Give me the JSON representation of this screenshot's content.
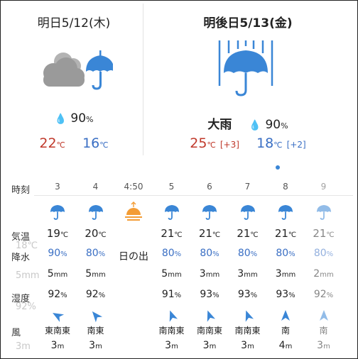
{
  "days": [
    {
      "date": "明日5/12(木)",
      "icon": "cloud-umbrella-icon",
      "prob": "90",
      "prob_unit": "%",
      "hi": "22",
      "lo": "16",
      "unit": "℃"
    },
    {
      "date": "明後日5/13(金)",
      "icon": "heavy-rain-umbrella-icon",
      "weather": "大雨",
      "prob": "90",
      "prob_unit": "%",
      "hi": "25",
      "lo": "18",
      "hi_diff": "[+3]",
      "lo_diff": "[+2]",
      "unit": "℃"
    }
  ],
  "labels": {
    "time": "時刻",
    "temp": "気温",
    "precip": "降水",
    "humidity": "湿度",
    "wind": "風",
    "sunrise": "日の出"
  },
  "ghost": {
    "temp": "18℃",
    "prob": "90%",
    "mm": "5mm",
    "hum": "92%",
    "wind": "3m"
  },
  "hours": [
    {
      "hour": "3",
      "temp": "19",
      "prob": "90",
      "mm": "5",
      "hum": "92",
      "dir": "東南東",
      "wind": "3",
      "arrow_deg": 300
    },
    {
      "hour": "4",
      "temp": "20",
      "prob": "80",
      "mm": "5",
      "hum": "92",
      "dir": "南東",
      "wind": "3",
      "arrow_deg": 320
    },
    {
      "hour": "4:50",
      "sunrise": true
    },
    {
      "hour": "5",
      "temp": "21",
      "prob": "80",
      "mm": "5",
      "hum": "91",
      "dir": "南南東",
      "wind": "3",
      "arrow_deg": 340
    },
    {
      "hour": "6",
      "temp": "21",
      "prob": "80",
      "mm": "3",
      "hum": "93",
      "dir": "南南東",
      "wind": "3",
      "arrow_deg": 340
    },
    {
      "hour": "7",
      "temp": "21",
      "prob": "80",
      "mm": "3",
      "hum": "93",
      "dir": "南南東",
      "wind": "3",
      "arrow_deg": 340
    },
    {
      "hour": "8",
      "temp": "21",
      "prob": "80",
      "mm": "3",
      "hum": "93",
      "dir": "南",
      "wind": "4",
      "arrow_deg": 0
    },
    {
      "hour": "9",
      "temp": "21",
      "prob": "80",
      "mm": "2",
      "hum": "92",
      "dir": "南",
      "wind": "3",
      "arrow_deg": 0,
      "faded": true
    }
  ],
  "units": {
    "temp": "℃",
    "prob": "%",
    "mm": "mm",
    "hum": "%",
    "wind": "m"
  },
  "colors": {
    "hi": "#c0392b",
    "lo": "#3a6fc4",
    "umbrella": "#3a86d6",
    "cloud": "#9a9a9a",
    "sun": "#f39c35"
  }
}
